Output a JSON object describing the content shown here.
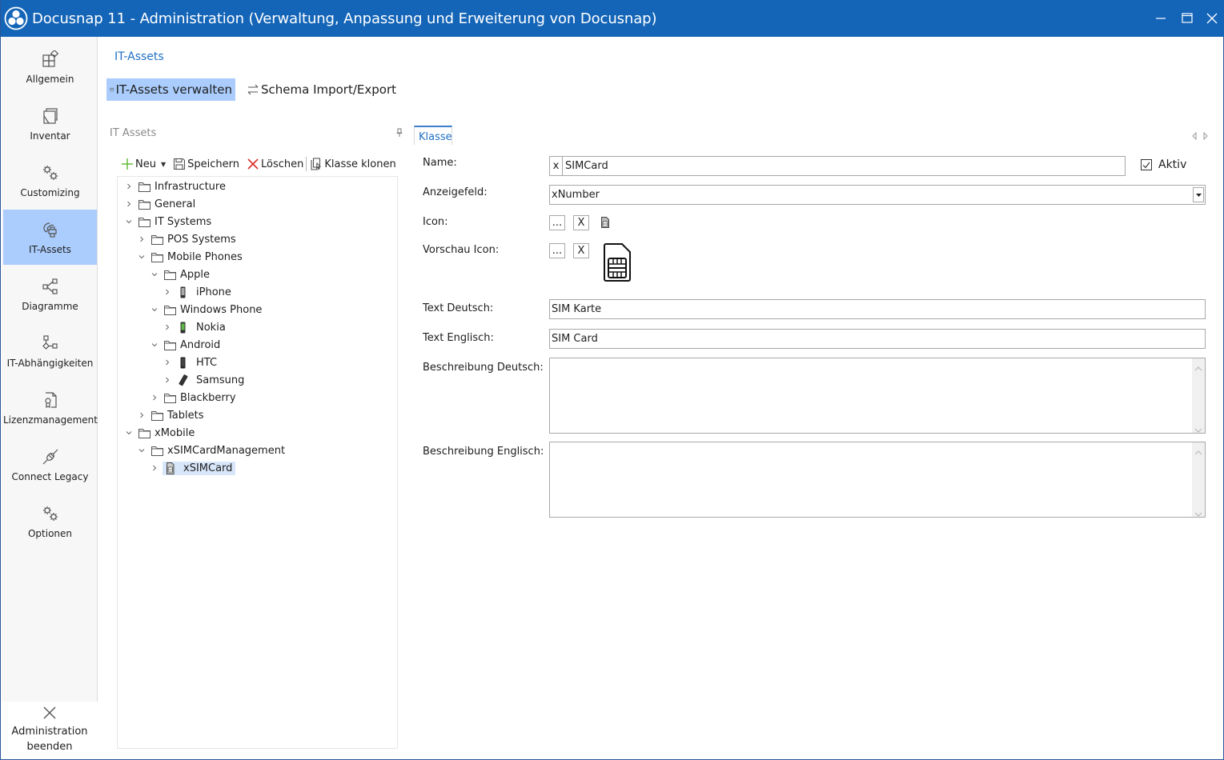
{
  "window": {
    "title": "Docusnap 11 - Administration (Verwaltung, Anpassung und Erweiterung von Docusnap)",
    "controls": [
      "minimize",
      "maximize",
      "close"
    ],
    "accent_color": "#1465b8"
  },
  "sidebar": {
    "items": [
      {
        "label": "Allgemein",
        "icon": "general-icon",
        "active": false
      },
      {
        "label": "Inventar",
        "icon": "inventory-icon",
        "active": false
      },
      {
        "label": "Customizing",
        "icon": "gears-icon",
        "active": false
      },
      {
        "label": "IT-Assets",
        "icon": "it-assets-icon",
        "active": true
      },
      {
        "label": "Diagramme",
        "icon": "diagram-icon",
        "active": false
      },
      {
        "label": "IT-Abhängigkeiten",
        "icon": "dependencies-icon",
        "active": false
      },
      {
        "label": "Lizenzmanagement",
        "icon": "license-icon",
        "active": false
      },
      {
        "label": "Connect Legacy",
        "icon": "plug-icon",
        "active": false
      },
      {
        "label": "Optionen",
        "icon": "gears-icon",
        "active": false
      }
    ],
    "exit": {
      "line1": "Administration",
      "line2": "beenden",
      "icon": "close-icon"
    },
    "active_color": "#abcdfd"
  },
  "header": {
    "breadcrumb": "IT-Assets",
    "tabs": [
      {
        "label": "IT-Assets verwalten",
        "icon": "archive-icon",
        "active": true
      },
      {
        "label": "Schema Import/Export",
        "icon": "swap-icon",
        "active": false
      }
    ]
  },
  "tree_panel": {
    "title": "IT Assets",
    "toolbar": {
      "new": "Neu",
      "save": "Speichern",
      "delete": "Löschen",
      "clone": "Klasse klonen"
    },
    "nodes": [
      {
        "label": "Infrastructure",
        "level": 0,
        "expanded": false,
        "icon": "folder"
      },
      {
        "label": "General",
        "level": 0,
        "expanded": false,
        "icon": "folder"
      },
      {
        "label": "IT Systems",
        "level": 0,
        "expanded": true,
        "icon": "folder"
      },
      {
        "label": "POS Systems",
        "level": 1,
        "expanded": false,
        "icon": "folder"
      },
      {
        "label": "Mobile Phones",
        "level": 1,
        "expanded": true,
        "icon": "folder"
      },
      {
        "label": "Apple",
        "level": 2,
        "expanded": true,
        "icon": "folder"
      },
      {
        "label": "iPhone",
        "level": 3,
        "expanded": false,
        "icon": "iphone"
      },
      {
        "label": "Windows Phone",
        "level": 2,
        "expanded": true,
        "icon": "folder"
      },
      {
        "label": "Nokia",
        "level": 3,
        "expanded": false,
        "icon": "nokia"
      },
      {
        "label": "Android",
        "level": 2,
        "expanded": true,
        "icon": "folder"
      },
      {
        "label": "HTC",
        "level": 3,
        "expanded": false,
        "icon": "htc"
      },
      {
        "label": "Samsung",
        "level": 3,
        "expanded": false,
        "icon": "samsung"
      },
      {
        "label": "Blackberry",
        "level": 2,
        "expanded": false,
        "icon": "folder"
      },
      {
        "label": "Tablets",
        "level": 1,
        "expanded": false,
        "icon": "folder"
      },
      {
        "label": "xMobile",
        "level": 0,
        "expanded": true,
        "icon": "folder"
      },
      {
        "label": "xSIMCardManagement",
        "level": 1,
        "expanded": true,
        "icon": "folder"
      },
      {
        "label": "xSIMCard",
        "level": 2,
        "expanded": false,
        "icon": "simcard",
        "selected": true
      }
    ]
  },
  "detail": {
    "tab": "Klasse",
    "fields": {
      "name_label": "Name:",
      "name_prefix": "x",
      "name_value": "SIMCard",
      "active_label": "Aktiv",
      "active_checked": true,
      "display_field_label": "Anzeigefeld:",
      "display_field_value": "xNumber",
      "icon_label": "Icon:",
      "preview_icon_label": "Vorschau Icon:",
      "browse_button": "...",
      "clear_button": "X",
      "text_de_label": "Text Deutsch:",
      "text_de_value": "SIM Karte",
      "text_en_label": "Text Englisch:",
      "text_en_value": "SIM Card",
      "desc_de_label": "Beschreibung Deutsch:",
      "desc_de_value": "",
      "desc_en_label": "Beschreibung Englisch:",
      "desc_en_value": ""
    }
  }
}
